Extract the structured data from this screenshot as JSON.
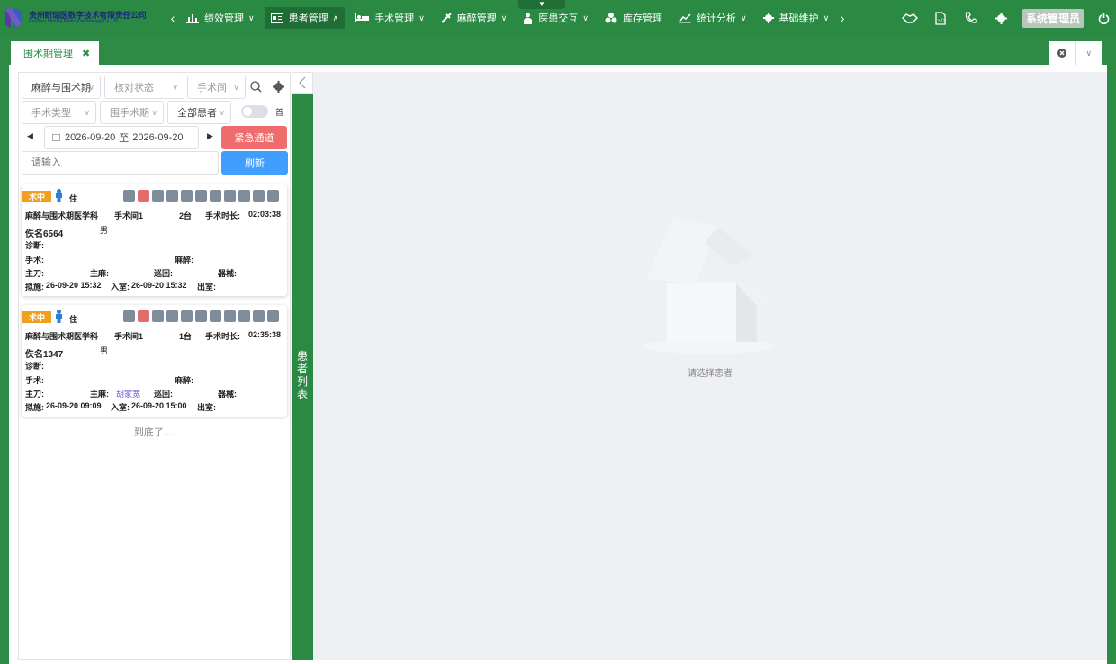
{
  "app": {
    "logo_cn": "贵州新瑞医数字技术有限责任公司",
    "logo_en": "GuiZhou Shining Medical technology Co.,Ltd"
  },
  "nav": [
    {
      "label": "绩效管理",
      "icon": "bar-chart-icon"
    },
    {
      "label": "患者管理",
      "icon": "id-card-icon",
      "active": true
    },
    {
      "label": "手术管理",
      "icon": "bed-icon"
    },
    {
      "label": "麻醉管理",
      "icon": "syringe-icon"
    },
    {
      "label": "医患交互",
      "icon": "doctor-icon"
    },
    {
      "label": "库存管理",
      "icon": "boxes-icon"
    },
    {
      "label": "统计分析",
      "icon": "line-chart-icon"
    },
    {
      "label": "基础维护",
      "icon": "gear-icon"
    }
  ],
  "header": {
    "admin_label": "系统管理员"
  },
  "tabs": [
    {
      "label": "围术期管理"
    }
  ],
  "filters": {
    "dept": "麻醉与围术期",
    "check_status": "核对状态",
    "room": "手术间",
    "op_type": "手术类型",
    "periop": "围手术期",
    "all_patients": "全部患者",
    "toggle_label": "首",
    "date_from": "2026-09-20",
    "date_sep": "至",
    "date_to": "2026-09-20",
    "emergency_label": "紧急通道",
    "search_placeholder": "请输入",
    "refresh_label": "刷新"
  },
  "patients": [
    {
      "status": "术中",
      "inpatient": "住",
      "dept": "麻醉与围术期医学科",
      "room": "手术间1",
      "seq": "2台",
      "duration_label": "手术时长:",
      "duration": "02:03:38",
      "name": "佚名6564",
      "gender": "男",
      "diagnosis_label": "诊断:",
      "surgery_label": "手术:",
      "anesthesia_label": "麻醉:",
      "surgeon_label": "主刀:",
      "anesthetist_label": "主麻:",
      "anesthetist": "",
      "circ_label": "巡回:",
      "instr_label": "器械:",
      "planned_label": "拟施:",
      "planned": "26-09-20 15:32",
      "in_label": "入室:",
      "in_time": "26-09-20 15:32",
      "out_label": "出室:"
    },
    {
      "status": "术中",
      "inpatient": "住",
      "dept": "麻醉与围术期医学科",
      "room": "手术间1",
      "seq": "1台",
      "duration_label": "手术时长:",
      "duration": "02:35:38",
      "name": "佚名1347",
      "gender": "男",
      "diagnosis_label": "诊断:",
      "surgery_label": "手术:",
      "anesthesia_label": "麻醉:",
      "surgeon_label": "主刀:",
      "anesthetist_label": "主麻:",
      "anesthetist": "胡家宽",
      "circ_label": "巡回:",
      "instr_label": "器械:",
      "planned_label": "拟施:",
      "planned": "26-09-20 09:09",
      "in_label": "入室:",
      "in_time": "26-09-20 15:00",
      "out_label": "出室:"
    }
  ],
  "list_end": "到底了....",
  "side_bar_label": "患者列表",
  "empty_state": "请选择患者",
  "colors": {
    "brand": "#2a8a44",
    "danger": "#f06c6c",
    "primary": "#409eff",
    "badge": "#f0a020"
  }
}
